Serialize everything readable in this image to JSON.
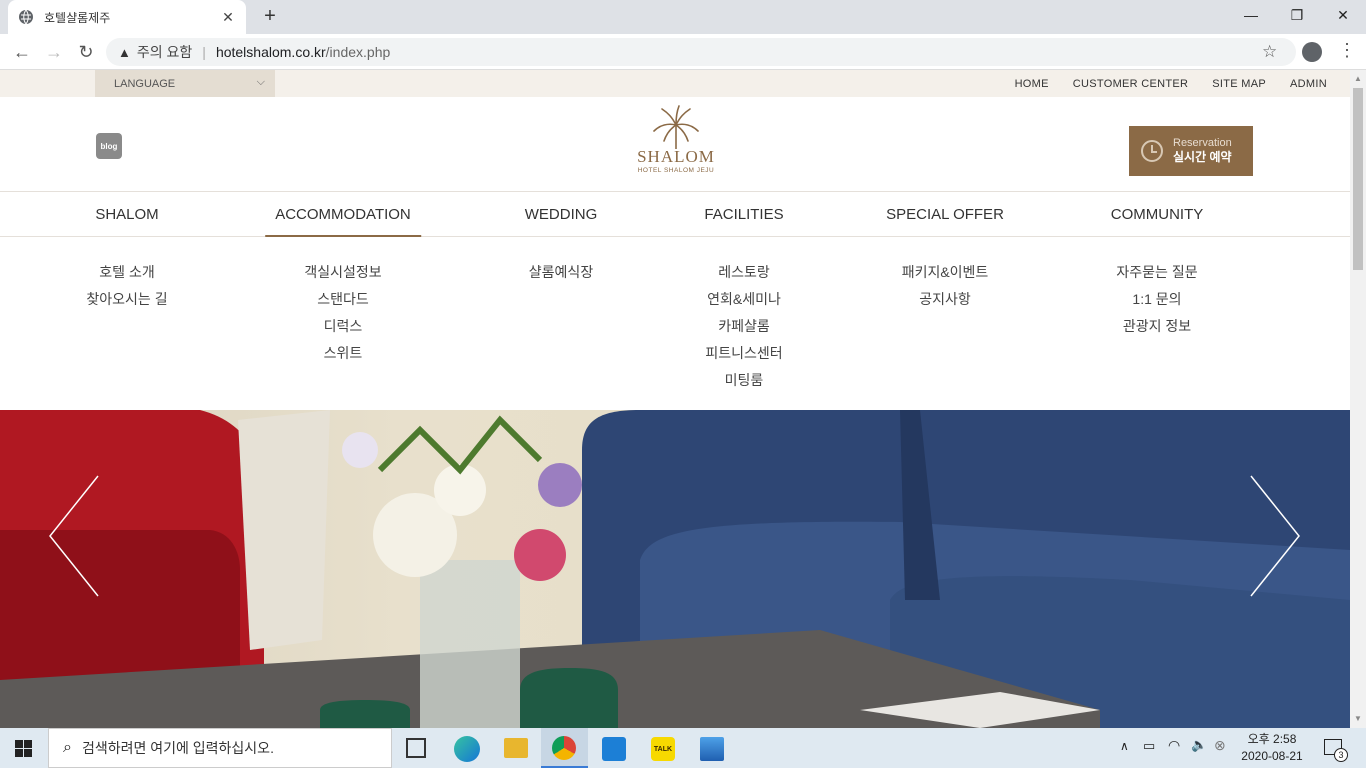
{
  "browser": {
    "tab_title": "호텔샬롬제주",
    "tab_close": "✕",
    "new_tab": "+",
    "win_minimize": "—",
    "win_maximize": "❐",
    "win_close": "✕",
    "security_warning": "주의 요함",
    "url_host": "hotelshalom.co.kr",
    "url_path": "/index.php"
  },
  "topbar": {
    "language_label": "LANGUAGE",
    "links": [
      "HOME",
      "CUSTOMER CENTER",
      "SITE MAP",
      "ADMIN"
    ]
  },
  "header": {
    "blog_label": "blog",
    "logo_text": "SHALOM",
    "logo_sub": "HOTEL SHALOM JEJU",
    "reservation_en": "Reservation",
    "reservation_ko": "실시간 예약"
  },
  "nav": {
    "items": [
      "SHALOM",
      "ACCOMMODATION",
      "WEDDING",
      "FACILITIES",
      "SPECIAL OFFER",
      "COMMUNITY"
    ],
    "active": "ACCOMMODATION"
  },
  "submenu": {
    "shalom": [
      "호텔 소개",
      "찾아오시는 길"
    ],
    "accommodation": [
      "객실시설정보",
      "스탠다드",
      "디럭스",
      "스위트"
    ],
    "wedding": [
      "샬롬예식장"
    ],
    "facilities": [
      "레스토랑",
      "연회&세미나",
      "카페샬롬",
      "피트니스센터",
      "미팅룸"
    ],
    "special_offer": [
      "패키지&이벤트",
      "공지사항"
    ],
    "community": [
      "자주묻는 질문",
      "1:1 문의",
      "관광지 정보"
    ]
  },
  "taskbar": {
    "search_placeholder": "검색하려면 여기에 입력하십시오.",
    "time": "오후 2:58",
    "date": "2020-08-21",
    "notification_count": "3"
  },
  "colors": {
    "brand": "#8b6a46",
    "topbar_bg": "#f4f0ea",
    "taskbar_bg": "#dfe9f1"
  }
}
